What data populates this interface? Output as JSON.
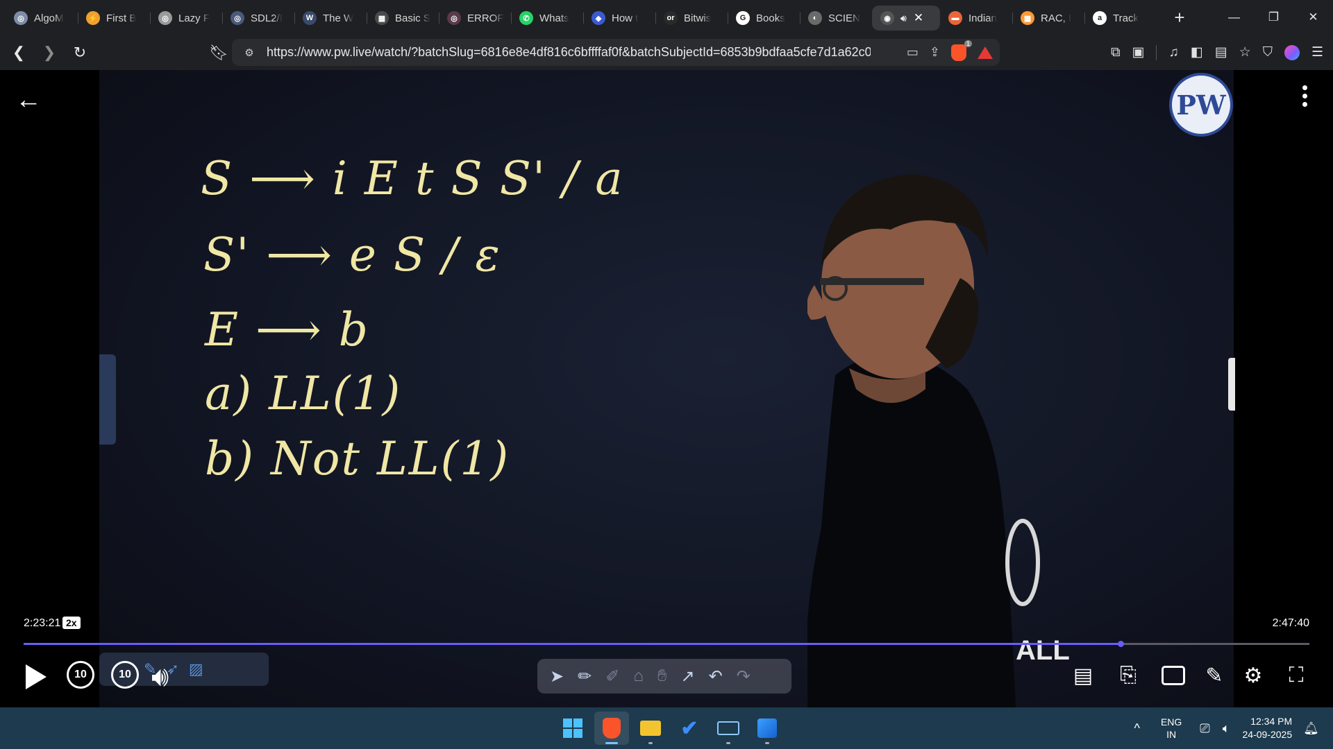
{
  "browser": {
    "tabs": [
      {
        "title": "AlgoM",
        "color": "#7d8da6",
        "glyph": "◎"
      },
      {
        "title": "First B",
        "color": "#f0a030",
        "glyph": "⚡"
      },
      {
        "title": "Lazy F",
        "color": "#9a9a9a",
        "glyph": "◎"
      },
      {
        "title": "SDL2/I",
        "color": "#4a5a7a",
        "glyph": "◎"
      },
      {
        "title": "The W",
        "color": "#3a4a6a",
        "glyph": "W"
      },
      {
        "title": "Basic S",
        "color": "#4a4a4a",
        "glyph": "▦"
      },
      {
        "title": "ERROF",
        "color": "#5a3a4a",
        "glyph": "◎"
      },
      {
        "title": "Whats",
        "color": "#25d366",
        "glyph": "✆"
      },
      {
        "title": "How t",
        "color": "#3a5ad0",
        "glyph": "◆"
      },
      {
        "title": "Bitwis",
        "color": "#2a2a2a",
        "glyph": "or"
      },
      {
        "title": "Books",
        "color": "#ffffff",
        "glyph": "G"
      },
      {
        "title": "SCIEN",
        "color": "#6a6a6a",
        "glyph": "◐"
      }
    ],
    "active_tab": {
      "title": "",
      "speaker_icon": "speaker-icon",
      "close_icon": "close-icon"
    },
    "tabs_after": [
      {
        "title": "Indian",
        "color": "#e8663a",
        "glyph": "▬"
      },
      {
        "title": "RAC, I",
        "color": "#ff9933",
        "glyph": "▦"
      },
      {
        "title": "Track",
        "color": "#ffffff",
        "glyph": "a"
      }
    ],
    "new_tab_label": "+",
    "url": "https://www.pw.live/watch/?batchSlug=6816e8e4df816c6bffffaf0f&batchSubjectId=6853b9bdfaa5cfe7d1a62c0...",
    "brave_badge": "1"
  },
  "video": {
    "board_lines": [
      "S ⟶ i E t S S' / a",
      "S' ⟶  e S / ε",
      "E ⟶ b",
      "a) LL(1)",
      "b) Not LL(1)"
    ],
    "logo_text": "PW",
    "shirt_text": "ALL",
    "current_time": "2:23:21",
    "speed": "2x",
    "duration": "2:47:40",
    "progress_fraction": 0.853,
    "skip_back_label": "10",
    "skip_forward_label": "10"
  },
  "taskbar": {
    "lang_line1": "ENG",
    "lang_line2": "IN",
    "time": "12:34 PM",
    "date": "24-09-2025"
  }
}
